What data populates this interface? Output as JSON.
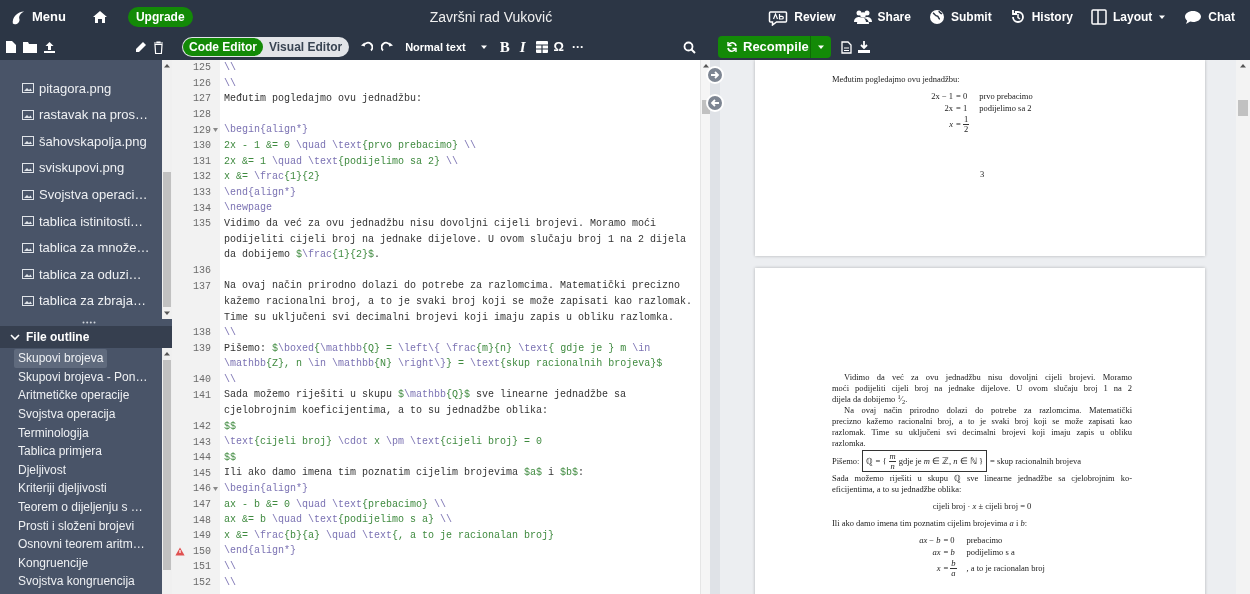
{
  "header": {
    "menu": "Menu",
    "upgrade": "Upgrade",
    "title": "Završni rad Vuković",
    "actions": [
      {
        "kind": "review",
        "label": "Review",
        "dropdown": false
      },
      {
        "kind": "share",
        "label": "Share",
        "dropdown": false
      },
      {
        "kind": "submit",
        "label": "Submit",
        "dropdown": false
      },
      {
        "kind": "history",
        "label": "History",
        "dropdown": false
      },
      {
        "kind": "layout",
        "label": "Layout",
        "dropdown": true
      },
      {
        "kind": "chat",
        "label": "Chat",
        "dropdown": false
      }
    ]
  },
  "toolbar": {
    "editor_modes": [
      {
        "label": "Code Editor",
        "selected": true
      },
      {
        "label": "Visual Editor",
        "selected": false
      }
    ],
    "text_style": "Normal text",
    "bold": "B",
    "italic": "I",
    "symbol": "Ω",
    "more": "···",
    "recompile": "Recompile"
  },
  "file_tree": [
    {
      "name": "pitagora.png"
    },
    {
      "name": "rastavak na pros…"
    },
    {
      "name": "šahovskapolja.png"
    },
    {
      "name": "sviskupovi.png"
    },
    {
      "name": "Svojstva operaci…"
    },
    {
      "name": "tablica istinitosti…"
    },
    {
      "name": "tablica za množe…"
    },
    {
      "name": "tablica za oduzi…"
    },
    {
      "name": "tablica za zbraja…"
    }
  ],
  "file_outline": {
    "title": "File outline",
    "expanded": true,
    "items": [
      {
        "label": "Skupovi brojeva",
        "selected": true
      },
      {
        "label": "Skupovi brojeva - Pon…",
        "selected": false
      },
      {
        "label": "Aritmetičke operacije",
        "selected": false
      },
      {
        "label": "Svojstva operacija",
        "selected": false
      },
      {
        "label": "Terminologija",
        "selected": false
      },
      {
        "label": "Tablica primjera",
        "selected": false
      },
      {
        "label": "Djeljivost",
        "selected": false
      },
      {
        "label": "Kriteriji djeljivosti",
        "selected": false
      },
      {
        "label": "Teorem o dijeljenju s …",
        "selected": false
      },
      {
        "label": "Prosti i složeni brojevi",
        "selected": false
      },
      {
        "label": "Osnovni teorem aritm…",
        "selected": false
      },
      {
        "label": "Kongruencije",
        "selected": false
      },
      {
        "label": "Svojstva kongruencija",
        "selected": false
      }
    ]
  },
  "editor": {
    "lines": [
      {
        "number": "125",
        "fold": false,
        "warning": false,
        "rows": [
          {
            "segments": [
              {
                "kind": "cmd",
                "text": "\\\\"
              }
            ]
          }
        ]
      },
      {
        "number": "126",
        "fold": false,
        "warning": false,
        "rows": [
          {
            "segments": [
              {
                "kind": "cmd",
                "text": "\\\\"
              }
            ]
          }
        ]
      },
      {
        "number": "127",
        "fold": false,
        "warning": false,
        "rows": [
          {
            "segments": [
              {
                "kind": "text",
                "text": "Međutim pogledajmo ovu jednadžbu:"
              }
            ]
          }
        ]
      },
      {
        "number": "128",
        "fold": false,
        "warning": false
      },
      {
        "number": "129",
        "fold": true,
        "warning": false,
        "rows": [
          {
            "segments": [
              {
                "kind": "cmd",
                "text": "\\begin{align*}"
              }
            ]
          }
        ]
      },
      {
        "number": "130",
        "fold": false,
        "warning": false,
        "rows": [
          {
            "segments": [
              {
                "kind": "math",
                "text": "2x - 1 &= 0 "
              },
              {
                "kind": "cmd",
                "text": "\\quad \\text"
              },
              {
                "kind": "math",
                "text": "{prvo prebacimo}"
              },
              {
                "kind": "cmd",
                "text": " \\\\"
              }
            ]
          }
        ]
      },
      {
        "number": "131",
        "fold": false,
        "warning": false,
        "rows": [
          {
            "segments": [
              {
                "kind": "math",
                "text": "2x &= 1 "
              },
              {
                "kind": "cmd",
                "text": "\\quad \\text"
              },
              {
                "kind": "math",
                "text": "{podijelimo sa 2}"
              },
              {
                "kind": "cmd",
                "text": " \\\\"
              }
            ]
          }
        ]
      },
      {
        "number": "132",
        "fold": false,
        "warning": false,
        "rows": [
          {
            "segments": [
              {
                "kind": "math",
                "text": "x &= "
              },
              {
                "kind": "cmd",
                "text": "\\frac"
              },
              {
                "kind": "math",
                "text": "{1}{2}"
              }
            ]
          }
        ]
      },
      {
        "number": "133",
        "fold": false,
        "warning": false,
        "rows": [
          {
            "segments": [
              {
                "kind": "cmd",
                "text": "\\end{align*}"
              }
            ]
          }
        ]
      },
      {
        "number": "134",
        "fold": false,
        "warning": false,
        "rows": [
          {
            "segments": [
              {
                "kind": "cmd",
                "text": "\\newpage"
              }
            ]
          }
        ]
      },
      {
        "number": "135",
        "fold": false,
        "warning": false,
        "rows": [
          {
            "segments": [
              {
                "kind": "text",
                "text": "Vidimo da već za ovu jednadžbu nisu dovoljni cijeli brojevi. Moramo moći"
              }
            ]
          },
          {
            "segments": [
              {
                "kind": "text",
                "text": "podijeliti cijeli broj na jednake dijelove. U ovom slučaju broj 1 na 2 dijela"
              }
            ]
          },
          {
            "segments": [
              {
                "kind": "text",
                "text": "da dobijemo "
              },
              {
                "kind": "math",
                "text": "$"
              },
              {
                "kind": "cmd",
                "text": "\\frac"
              },
              {
                "kind": "math",
                "text": "{1}{2}$"
              },
              {
                "kind": "text",
                "text": "."
              }
            ]
          }
        ]
      },
      {
        "number": "136",
        "fold": false,
        "warning": false
      },
      {
        "number": "137",
        "fold": false,
        "warning": false,
        "rows": [
          {
            "segments": [
              {
                "kind": "text",
                "text": "Na ovaj način prirodno dolazi do potrebe za razlomcima. Matematički precizno"
              }
            ]
          },
          {
            "segments": [
              {
                "kind": "text",
                "text": "kažemo racionalni broj, a to je svaki broj koji se može zapisati kao razlomak."
              }
            ]
          },
          {
            "segments": [
              {
                "kind": "text",
                "text": "Time su uključeni svi decimalni brojevi koji imaju zapis u obliku razlomka."
              }
            ]
          }
        ]
      },
      {
        "number": "138",
        "fold": false,
        "warning": false,
        "rows": [
          {
            "segments": [
              {
                "kind": "cmd",
                "text": "\\\\"
              }
            ]
          }
        ]
      },
      {
        "number": "139",
        "fold": false,
        "warning": false,
        "rows": [
          {
            "segments": [
              {
                "kind": "text",
                "text": "Pišemo: "
              },
              {
                "kind": "math",
                "text": "$"
              },
              {
                "kind": "cmd",
                "text": "\\boxed"
              },
              {
                "kind": "math",
                "text": "{"
              },
              {
                "kind": "cmd",
                "text": "\\mathbb"
              },
              {
                "kind": "math",
                "text": "{Q} = "
              },
              {
                "kind": "cmd",
                "text": "\\left\\{ \\frac"
              },
              {
                "kind": "math",
                "text": "{m}{n} "
              },
              {
                "kind": "cmd",
                "text": "\\text"
              },
              {
                "kind": "math",
                "text": "{ gdje je } m "
              },
              {
                "kind": "cmd",
                "text": "\\in"
              }
            ]
          },
          {
            "segments": [
              {
                "kind": "cmd",
                "text": "\\mathbb"
              },
              {
                "kind": "math",
                "text": "{Z}, n "
              },
              {
                "kind": "cmd",
                "text": "\\in \\mathbb"
              },
              {
                "kind": "math",
                "text": "{N} "
              },
              {
                "kind": "cmd",
                "text": "\\right\\}"
              },
              {
                "kind": "math",
                "text": "} = "
              },
              {
                "kind": "cmd",
                "text": "\\text"
              },
              {
                "kind": "math",
                "text": "{skup racionalnih brojeva}$"
              }
            ]
          }
        ]
      },
      {
        "number": "140",
        "fold": false,
        "warning": false,
        "rows": [
          {
            "segments": [
              {
                "kind": "cmd",
                "text": "\\\\"
              }
            ]
          }
        ]
      },
      {
        "number": "141",
        "fold": false,
        "warning": false,
        "rows": [
          {
            "segments": [
              {
                "kind": "text",
                "text": "Sada možemo riješiti u skupu "
              },
              {
                "kind": "math",
                "text": "$"
              },
              {
                "kind": "cmd",
                "text": "\\mathbb"
              },
              {
                "kind": "math",
                "text": "{Q}$"
              },
              {
                "kind": "text",
                "text": " sve linearne jednadžbe sa"
              }
            ]
          },
          {
            "segments": [
              {
                "kind": "text",
                "text": "cjelobrojnim koeficijentima, a to su jednadžbe oblika:"
              }
            ]
          }
        ]
      },
      {
        "number": "142",
        "fold": false,
        "warning": false,
        "rows": [
          {
            "segments": [
              {
                "kind": "math",
                "text": "$$"
              }
            ]
          }
        ]
      },
      {
        "number": "143",
        "fold": false,
        "warning": false,
        "rows": [
          {
            "segments": [
              {
                "kind": "cmd",
                "text": "\\text"
              },
              {
                "kind": "math",
                "text": "{cijeli broj} "
              },
              {
                "kind": "cmd",
                "text": "\\cdot"
              },
              {
                "kind": "math",
                "text": " x "
              },
              {
                "kind": "cmd",
                "text": "\\pm \\text"
              },
              {
                "kind": "math",
                "text": "{cijeli broj} = 0"
              }
            ]
          }
        ]
      },
      {
        "number": "144",
        "fold": false,
        "warning": false,
        "rows": [
          {
            "segments": [
              {
                "kind": "math",
                "text": "$$"
              }
            ]
          }
        ]
      },
      {
        "number": "145",
        "fold": false,
        "warning": false,
        "rows": [
          {
            "segments": [
              {
                "kind": "text",
                "text": "Ili ako damo imena tim poznatim cijelim brojevima "
              },
              {
                "kind": "math",
                "text": "$a$"
              },
              {
                "kind": "text",
                "text": " i "
              },
              {
                "kind": "math",
                "text": "$b$"
              },
              {
                "kind": "text",
                "text": ":"
              }
            ]
          }
        ]
      },
      {
        "number": "146",
        "fold": true,
        "warning": false,
        "rows": [
          {
            "segments": [
              {
                "kind": "cmd",
                "text": "\\begin{align*}"
              }
            ]
          }
        ]
      },
      {
        "number": "147",
        "fold": false,
        "warning": false,
        "rows": [
          {
            "segments": [
              {
                "kind": "math",
                "text": "ax - b &= 0 "
              },
              {
                "kind": "cmd",
                "text": "\\quad \\text"
              },
              {
                "kind": "math",
                "text": "{prebacimo}"
              },
              {
                "kind": "cmd",
                "text": " \\\\"
              }
            ]
          }
        ]
      },
      {
        "number": "148",
        "fold": false,
        "warning": false,
        "rows": [
          {
            "segments": [
              {
                "kind": "math",
                "text": "ax &= b "
              },
              {
                "kind": "cmd",
                "text": "\\quad \\text"
              },
              {
                "kind": "math",
                "text": "{podijelimo s a}"
              },
              {
                "kind": "cmd",
                "text": " \\\\"
              }
            ]
          }
        ]
      },
      {
        "number": "149",
        "fold": false,
        "warning": false,
        "rows": [
          {
            "segments": [
              {
                "kind": "math",
                "text": "x &= "
              },
              {
                "kind": "cmd",
                "text": "\\frac"
              },
              {
                "kind": "math",
                "text": "{b}{a} "
              },
              {
                "kind": "cmd",
                "text": "\\quad \\text"
              },
              {
                "kind": "math",
                "text": "{, a to je racionalan broj}"
              }
            ]
          }
        ]
      },
      {
        "number": "150",
        "fold": false,
        "warning": true,
        "rows": [
          {
            "segments": [
              {
                "kind": "cmd",
                "text": "\\end{align*}"
              }
            ]
          }
        ]
      },
      {
        "number": "151",
        "fold": false,
        "warning": false,
        "rows": [
          {
            "segments": [
              {
                "kind": "cmd",
                "text": "\\\\"
              }
            ]
          }
        ]
      },
      {
        "number": "152",
        "fold": false,
        "warning": false,
        "rows": [
          {
            "segments": [
              {
                "kind": "cmd",
                "text": "\\\\"
              }
            ]
          }
        ]
      }
    ]
  },
  "pdf": {
    "pages": [
      {
        "page_number": "3",
        "items": [
          {
            "kind": "para",
            "indent": false,
            "lines": [
              "Međutim pogledajmo ovu jednadžbu:"
            ]
          },
          {
            "kind": "align",
            "rows": [
              {
                "left": "2x − 1",
                "right": "= 0",
                "note": "prvo prebacimo"
              },
              {
                "left": "2x",
                "right": "= 1",
                "note": "podijelimo sa 2"
              },
              {
                "left": "*x*",
                "right": "=",
                "frac": [
                  "1",
                  "2"
                ]
              }
            ]
          }
        ]
      },
      {
        "items": [
          {
            "kind": "para",
            "indent": true,
            "lines": [
              "Vidimo da već za ovu jednadžbu nisu dovoljni cijeli brojevi. Moramo",
              "moći podijeliti cijeli broj na jednake dijelove. U ovom slučaju broj 1 na 2",
              "dijela da dobijemo $^{1}$⁄$_{2}$."
            ]
          },
          {
            "kind": "para",
            "indent": true,
            "lines": [
              "Na ovaj način prirodno dolazi do potrebe za razlomcima. Matematički",
              "precizno kažemo racionalni broj, a to je svaki broj koji se može zapisati kao",
              "razlomak. Time su uključeni svi decimalni brojevi koji imaju zapis u obliku",
              "razlomka."
            ]
          },
          {
            "kind": "boxed",
            "lead": "Pišemo:",
            "before": "ℚ = {",
            "frac": [
              "*m*",
              "*n*"
            ],
            "after": "gdje je *m* ∈ ℤ, *n* ∈ ℕ }",
            "tail": "= skup racionalnih brojeva"
          },
          {
            "kind": "para",
            "indent": false,
            "lines": [
              "Sada možemo riješiti u skupu ℚ sve linearne jednadžbe sa cjelobrojnim ko-",
              "eficijentima, a to su jednadžbe oblika:"
            ]
          },
          {
            "kind": "display",
            "text": "cijeli broj · *x* ± cijeli broj = 0"
          },
          {
            "kind": "para",
            "indent": false,
            "lines": [
              "Ili ako damo imena tim poznatim cijelim brojevima *a* i *b*:"
            ]
          },
          {
            "kind": "align",
            "rows": [
              {
                "left": "*ax* − *b*",
                "right": "= 0",
                "note": "prebacimo"
              },
              {
                "left": "*ax*",
                "right": "= *b*",
                "note": "podijelimo s a"
              },
              {
                "left": "*x*",
                "right": "=",
                "frac": [
                  "*b*",
                  "*a*"
                ],
                "note": ", a to je racionalan broj"
              }
            ]
          }
        ]
      }
    ]
  }
}
